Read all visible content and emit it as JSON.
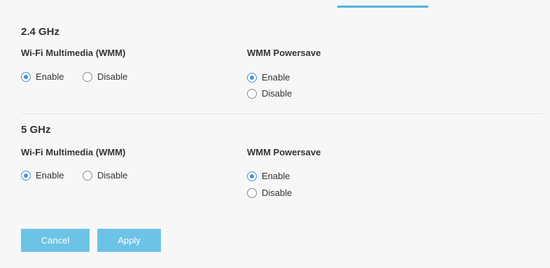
{
  "sections": [
    {
      "title": "2.4 GHz",
      "wmm": {
        "label": "Wi-Fi Multimedia (WMM)",
        "options": [
          "Enable",
          "Disable"
        ],
        "selected": "Enable"
      },
      "powersave": {
        "label": "WMM Powersave",
        "options": [
          "Enable",
          "Disable"
        ],
        "selected": "Enable"
      }
    },
    {
      "title": "5 GHz",
      "wmm": {
        "label": "Wi-Fi Multimedia (WMM)",
        "options": [
          "Enable",
          "Disable"
        ],
        "selected": "Enable"
      },
      "powersave": {
        "label": "WMM Powersave",
        "options": [
          "Enable",
          "Disable"
        ],
        "selected": "Enable"
      }
    }
  ],
  "buttons": {
    "cancel": "Cancel",
    "apply": "Apply"
  },
  "colors": {
    "accent": "#4a90d9",
    "button": "#6cc3e6",
    "tab_indicator": "#4fb3df"
  }
}
